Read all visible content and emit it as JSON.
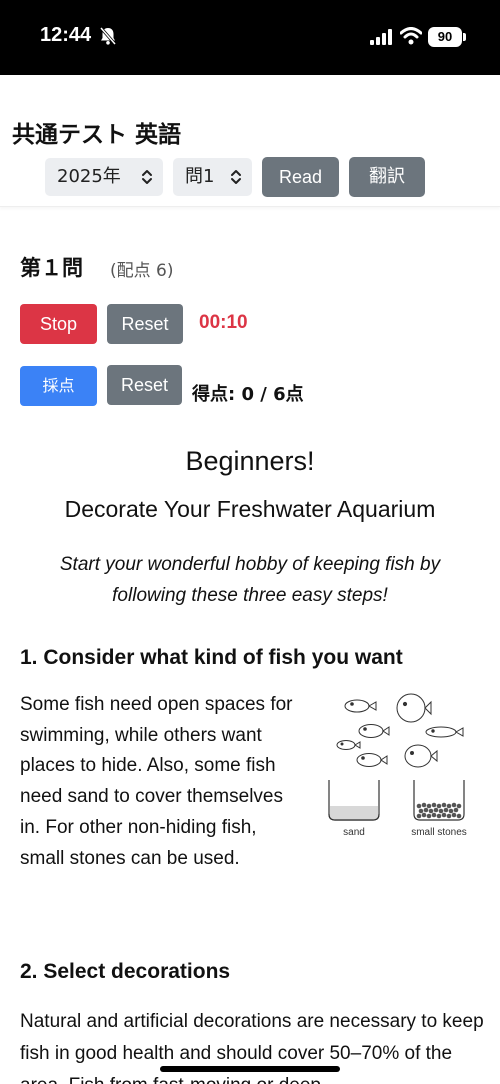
{
  "status_bar": {
    "time": "12:44",
    "battery": "90"
  },
  "header": {
    "title": "共通テスト 英語",
    "year_select": "2025年",
    "question_select": "問1",
    "read_button": "Read",
    "translate_button": "翻訳"
  },
  "question": {
    "heading": "第１問",
    "points": "(配点 6)",
    "stop_button": "Stop",
    "reset_button": "Reset",
    "timer": "00:10",
    "grade_button": "採点",
    "score": "得点: 0 / 6点"
  },
  "document": {
    "title": "Beginners!",
    "subtitle": "Decorate Your Freshwater Aquarium",
    "intro": "Start your wonderful hobby of keeping fish by following these three easy steps!",
    "section1_heading": "1. Consider what kind of fish you want",
    "section1_text": "Some fish need open spaces for swimming, while others want places to hide. Also, some fish need sand to cover themselves in. For other non-hiding fish, small stones can be used.",
    "figure_label_sand": "sand",
    "figure_label_stones": "small stones",
    "section2_heading": "2. Select decorations",
    "section2_text": "Natural and artificial decorations are necessary to keep fish in good health and should cover 50–70% of the area. Fish from fast-moving or deep"
  },
  "colors": {
    "danger": "#dc3545",
    "secondary": "#6c757d",
    "primary": "#3b82f6"
  }
}
